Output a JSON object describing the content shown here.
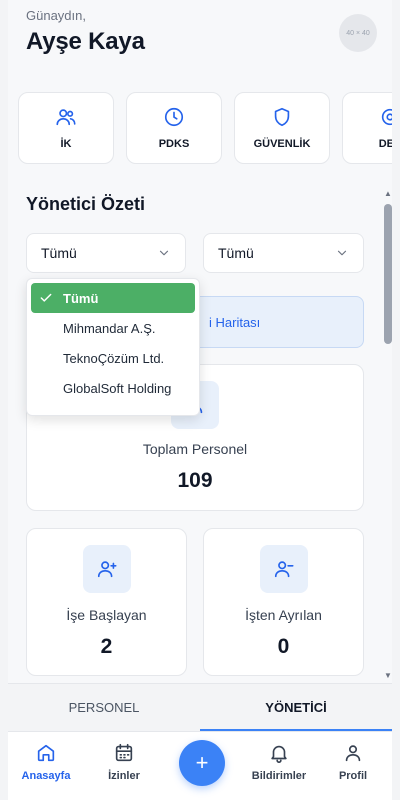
{
  "header": {
    "greeting": "Günaydın,",
    "user_name": "Ayşe Kaya",
    "avatar_placeholder": "40 × 40"
  },
  "quick_actions": [
    {
      "label": "İK",
      "icon": "users-icon"
    },
    {
      "label": "PDKS",
      "icon": "clock-icon"
    },
    {
      "label": "GÜVENLİK",
      "icon": "shield-icon"
    },
    {
      "label": "DES",
      "icon": "headset-icon"
    }
  ],
  "section": {
    "title": "Yönetici Özeti"
  },
  "filters": {
    "company_value": "Tümü",
    "second_value": "Tümü"
  },
  "dropdown": {
    "options": [
      "Tümü",
      "Mihmandar A.Ş.",
      "TeknoÇözüm Ltd.",
      "GlobalSoft Holding"
    ],
    "selected_index": 0
  },
  "map_button": {
    "label": "i Haritası"
  },
  "stats": {
    "total": {
      "label": "Toplam Personel",
      "value": "109"
    },
    "starting": {
      "label": "İşe Başlayan",
      "value": "2"
    },
    "leaving": {
      "label": "İşten Ayrılan",
      "value": "0"
    }
  },
  "subtabs": [
    {
      "label": "PERSONEL",
      "active": false
    },
    {
      "label": "YÖNETİCİ",
      "active": true
    }
  ],
  "bottom_nav": [
    {
      "label": "Anasayfa",
      "icon": "home-icon",
      "active": true
    },
    {
      "label": "İzinler",
      "icon": "calendar-icon",
      "active": false
    },
    {
      "label": "Bildirimler",
      "icon": "bell-icon",
      "active": false
    },
    {
      "label": "Profil",
      "icon": "user-icon",
      "active": false
    }
  ],
  "fab": {
    "label": "+"
  },
  "colors": {
    "accent": "#3b82f6",
    "selected_option": "#4caf66",
    "icon_bg": "#e8f0fb"
  }
}
